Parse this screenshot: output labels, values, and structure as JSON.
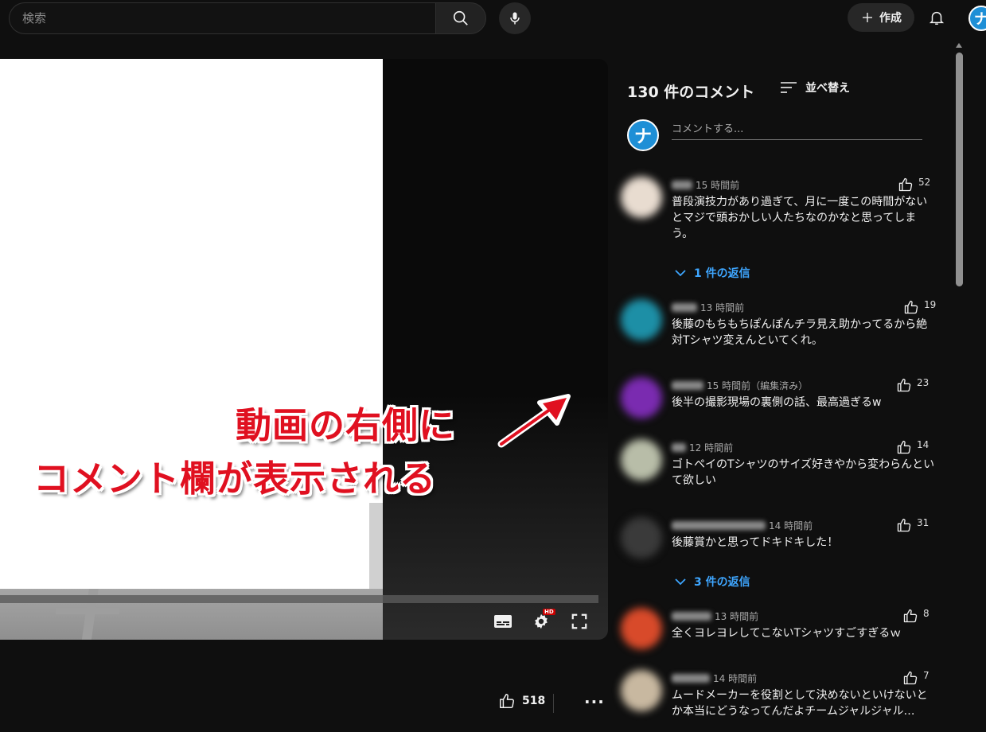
{
  "header": {
    "search_placeholder": "検索",
    "create_label": "作成",
    "avatar_letter": "ナ"
  },
  "video": {
    "likes": "518",
    "more": "···"
  },
  "annotation": {
    "line1": "動画の右側に",
    "line2": "コメント欄が表示される",
    "color": "#e01020"
  },
  "comments": {
    "header": "130 件のコメント",
    "sort_label": "並べ替え",
    "input_placeholder": "コメントする...",
    "avatar_letter": "ナ",
    "items": [
      {
        "time": "15 時間前",
        "text": "普段演技力があり過ぎて、月に一度この時間がないとマジで頭おかしい人たちなのかなと思ってしまう。",
        "likes": "52"
      },
      {
        "time": "13 時間前",
        "text": "後藤のもちもちぽんぽんチラ見え助かってるから絶対Tシャツ変えんといてくれ。",
        "likes": "19"
      },
      {
        "time": "15 時間前（編集済み）",
        "text": "後半の撮影現場の裏側の話、最高過ぎるw",
        "likes": "23"
      },
      {
        "time": "12 時間前",
        "text": "ゴトペイのTシャツのサイズ好きやから変わらんといて欲しい",
        "likes": "14"
      },
      {
        "time": "14 時間前",
        "text": "後藤賞かと思ってドキドキした！",
        "likes": "31"
      },
      {
        "time": "13 時間前",
        "text": "全くヨレヨレしてこないTシャツすごすぎるｗ",
        "likes": "8"
      },
      {
        "time": "14 時間前",
        "text": "ムードメーカーを役割として決めないといけないとか本当にどうなってんだよチームジャルジャル…",
        "likes": "7"
      }
    ],
    "replies": [
      {
        "label": "1 件の返信"
      },
      {
        "label": "3 件の返信"
      }
    ]
  },
  "colors": {
    "background": "#0f0f0f",
    "reply_link": "#3ea6ff",
    "hd_badge": "#cc0000",
    "avatar_blue": "#1e8fd6"
  }
}
